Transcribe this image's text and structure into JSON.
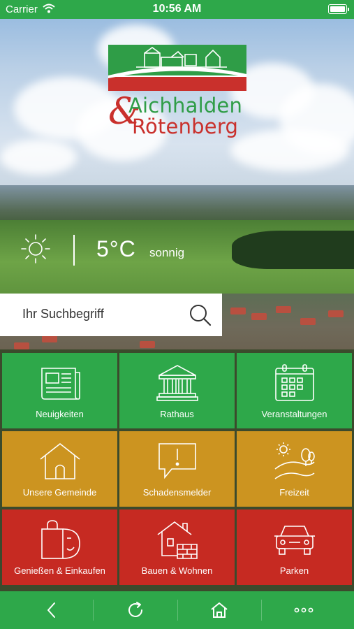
{
  "status_bar": {
    "carrier": "Carrier",
    "time": "10:56 AM",
    "battery_level": 1.0
  },
  "logo": {
    "amp": "&",
    "line1": "Aichhalden",
    "line2": "Rötenberg",
    "colors": {
      "green": "#2f9d47",
      "red": "#c9302c"
    }
  },
  "weather": {
    "icon": "sun-icon",
    "temperature": "5°C",
    "description": "sonnig"
  },
  "search": {
    "placeholder": "Ihr Suchbegriff",
    "icon": "search-icon"
  },
  "tiles": [
    {
      "label": "Neuigkeiten",
      "icon": "newspaper-icon",
      "color": "#2ea84a"
    },
    {
      "label": "Rathaus",
      "icon": "town-hall-icon",
      "color": "#2ea84a"
    },
    {
      "label": "Veranstaltungen",
      "icon": "calendar-icon",
      "color": "#2ea84a"
    },
    {
      "label": "Unsere Gemeinde",
      "icon": "house-icon",
      "color": "#cc9420"
    },
    {
      "label": "Schadensmelder",
      "icon": "alert-speech-icon",
      "color": "#cc9420"
    },
    {
      "label": "Freizeit",
      "icon": "landscape-icon",
      "color": "#cc9420"
    },
    {
      "label": "Genießen & Einkaufen",
      "icon": "shopping-bag-icon",
      "color": "#c62a22"
    },
    {
      "label": "Bauen & Wohnen",
      "icon": "building-icon",
      "color": "#c62a22"
    },
    {
      "label": "Parken",
      "icon": "car-icon",
      "color": "#c62a22"
    }
  ],
  "bottom_nav": [
    {
      "icon": "back-icon"
    },
    {
      "icon": "reload-icon"
    },
    {
      "icon": "home-icon"
    },
    {
      "icon": "more-icon"
    }
  ],
  "theme": {
    "green": "#2ea84a",
    "orange": "#cc9420",
    "red": "#c62a22"
  }
}
